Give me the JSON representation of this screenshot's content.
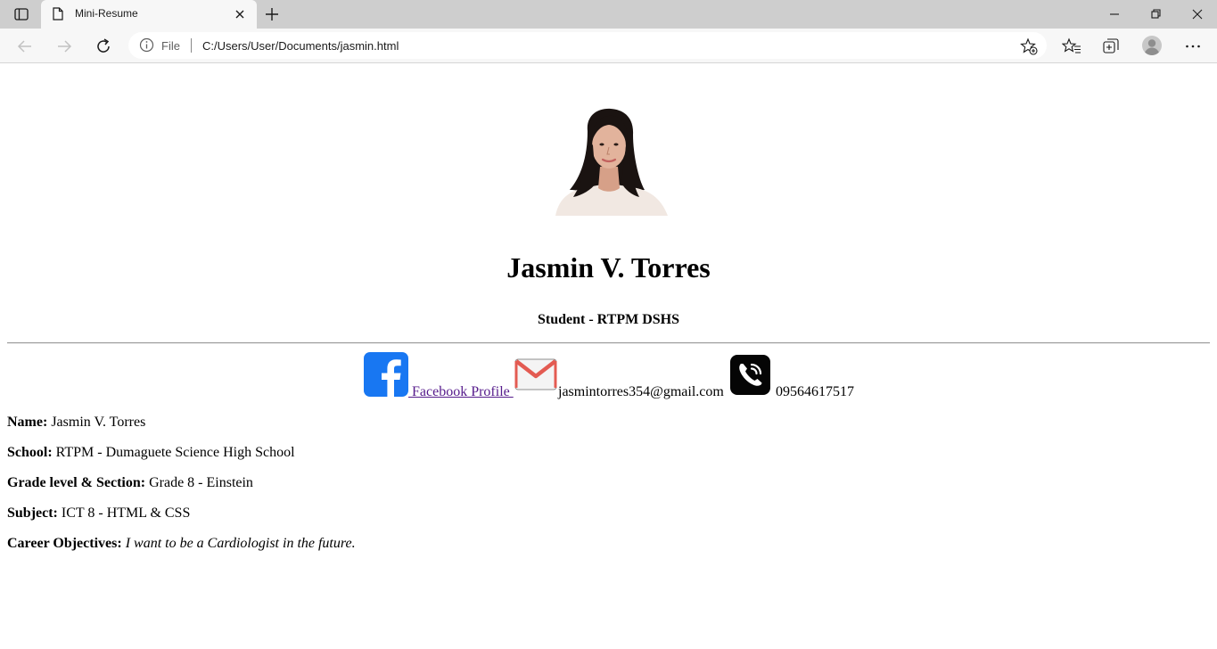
{
  "browser": {
    "tab_title": "Mini-Resume",
    "omnibox": {
      "scheme_label": "File",
      "url": "C:/Users/User/Documents/jasmin.html"
    },
    "icons": [
      "tab-actions-icon",
      "page-icon",
      "close-icon",
      "plus-icon",
      "minimize-icon",
      "restore-icon",
      "close-window-icon",
      "back-arrow-icon",
      "forward-arrow-icon",
      "refresh-icon",
      "info-icon",
      "add-favorite-icon",
      "favorites-icon",
      "collections-icon",
      "profile-icon",
      "more-icon"
    ]
  },
  "resume": {
    "name_heading": "Jasmin V. Torres",
    "subtitle": "Student - RTPM DSHS",
    "contacts": {
      "facebook_label": " Facebook Profile ",
      "email": "jasmintorres354@gmail.com",
      "phone": "09564617517"
    },
    "details": [
      {
        "label": "Name:",
        "value": "Jasmin V. Torres"
      },
      {
        "label": "School:",
        "value": "RTPM - Dumaguete Science High School"
      },
      {
        "label": "Grade level & Section:",
        "value": "Grade 8 - Einstein"
      },
      {
        "label": "Subject:",
        "value": "ICT 8 - HTML & CSS"
      },
      {
        "label": "Career Objectives:",
        "value": "I want to be a Cardiologist in the future."
      }
    ]
  },
  "colors": {
    "link_visited": "#551a8b",
    "facebook_blue": "#1877f2",
    "tab_strip": "#cecece",
    "toolbar": "#f7f7f7"
  }
}
